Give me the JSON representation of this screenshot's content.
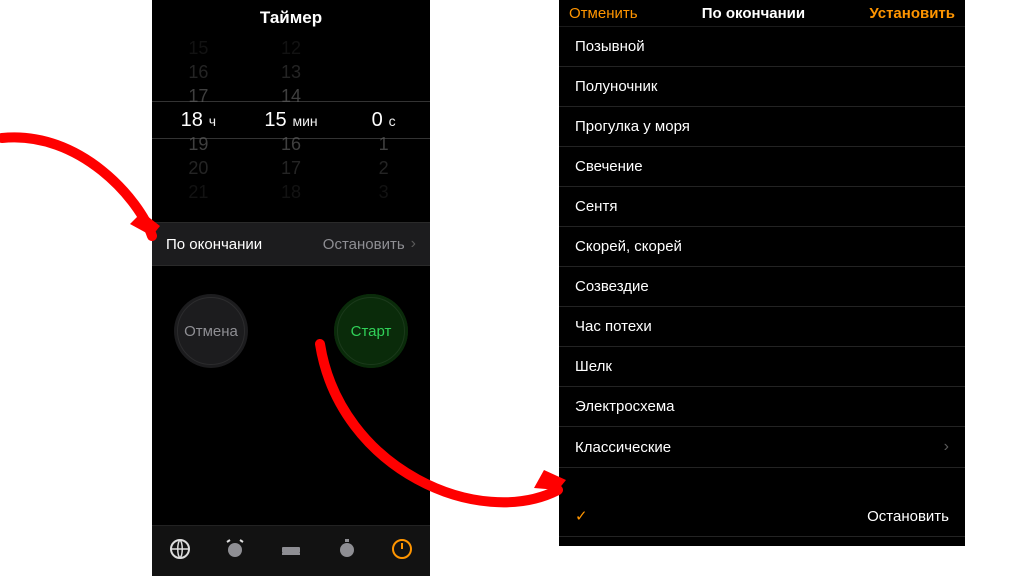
{
  "phone1": {
    "title": "Таймер",
    "picker": {
      "hours": {
        "values": [
          "15",
          "16",
          "17",
          "18",
          "19",
          "20",
          "21"
        ],
        "selectedIndex": 3,
        "unit": "ч"
      },
      "minutes": {
        "values": [
          "12",
          "13",
          "14",
          "15",
          "16",
          "17",
          "18"
        ],
        "selectedIndex": 3,
        "unit": "мин"
      },
      "seconds": {
        "values": [
          "",
          "",
          "",
          "0",
          "1",
          "2",
          "3"
        ],
        "selectedIndex": 3,
        "unit": "с"
      }
    },
    "endRow": {
      "label": "По окончании",
      "value": "Остановить"
    },
    "buttons": {
      "cancel": "Отмена",
      "start": "Старт"
    },
    "tabs": [
      "world-clock",
      "alarm",
      "bedtime",
      "stopwatch",
      "timer"
    ],
    "activeTab": 4
  },
  "phone2": {
    "nav": {
      "left": "Отменить",
      "title": "По окончании",
      "right": "Установить"
    },
    "sounds": [
      "Позывной",
      "Полуночник",
      "Прогулка у моря",
      "Свечение",
      "Сентя",
      "Скорей, скорей",
      "Созвездие",
      "Час потехи",
      "Шелк",
      "Электросхема"
    ],
    "classic": "Классические",
    "stop": "Остановить"
  }
}
